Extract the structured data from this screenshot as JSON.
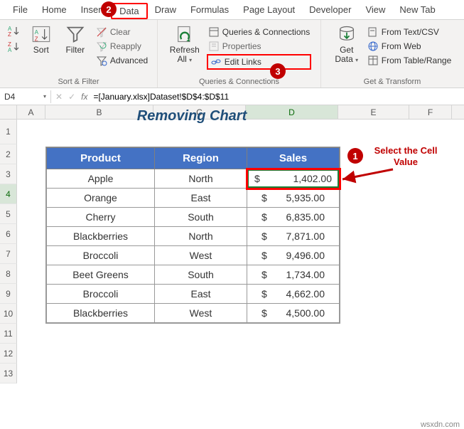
{
  "tabs": [
    "File",
    "Home",
    "Insert",
    "Data",
    "Draw",
    "Formulas",
    "Page Layout",
    "Developer",
    "View",
    "New Tab"
  ],
  "activeTab": "Data",
  "ribbon": {
    "sortfilter": {
      "sort": "Sort",
      "filter": "Filter",
      "clear": "Clear",
      "reapply": "Reapply",
      "advanced": "Advanced",
      "label": "Sort & Filter"
    },
    "queries": {
      "refresh": "Refresh All",
      "qc": "Queries & Connections",
      "props": "Properties",
      "editlinks": "Edit Links",
      "label": "Queries & Connections"
    },
    "getdata": {
      "get": "Get Data",
      "textcsv": "From Text/CSV",
      "web": "From Web",
      "table": "From Table/Range",
      "label": "Get & Transform"
    }
  },
  "namebox": "D4",
  "formula": "=[January.xlsx]Dataset!$D$4:$D$11",
  "cols": [
    "A",
    "B",
    "C",
    "D",
    "E",
    "F"
  ],
  "rows": [
    "1",
    "2",
    "3",
    "4",
    "5",
    "6",
    "7",
    "8",
    "9",
    "10",
    "11",
    "12",
    "13"
  ],
  "title": "Removing Chart",
  "tableHeaders": {
    "product": "Product",
    "region": "Region",
    "sales": "Sales"
  },
  "tableData": [
    {
      "p": "Apple",
      "r": "North",
      "s": "1,402.00"
    },
    {
      "p": "Orange",
      "r": "East",
      "s": "5,935.00"
    },
    {
      "p": "Cherry",
      "r": "South",
      "s": "6,835.00"
    },
    {
      "p": "Blackberries",
      "r": "North",
      "s": "7,871.00"
    },
    {
      "p": "Broccoli",
      "r": "West",
      "s": "9,496.00"
    },
    {
      "p": "Beet Greens",
      "r": "South",
      "s": "1,734.00"
    },
    {
      "p": "Broccoli",
      "r": "East",
      "s": "4,662.00"
    },
    {
      "p": "Blackberries",
      "r": "West",
      "s": "4,500.00"
    }
  ],
  "callouts": {
    "step1_label": "Select the Cell Value",
    "badge1": "1",
    "badge2": "2",
    "badge3": "3"
  },
  "watermark": "wsxdn.com",
  "currency": "$"
}
